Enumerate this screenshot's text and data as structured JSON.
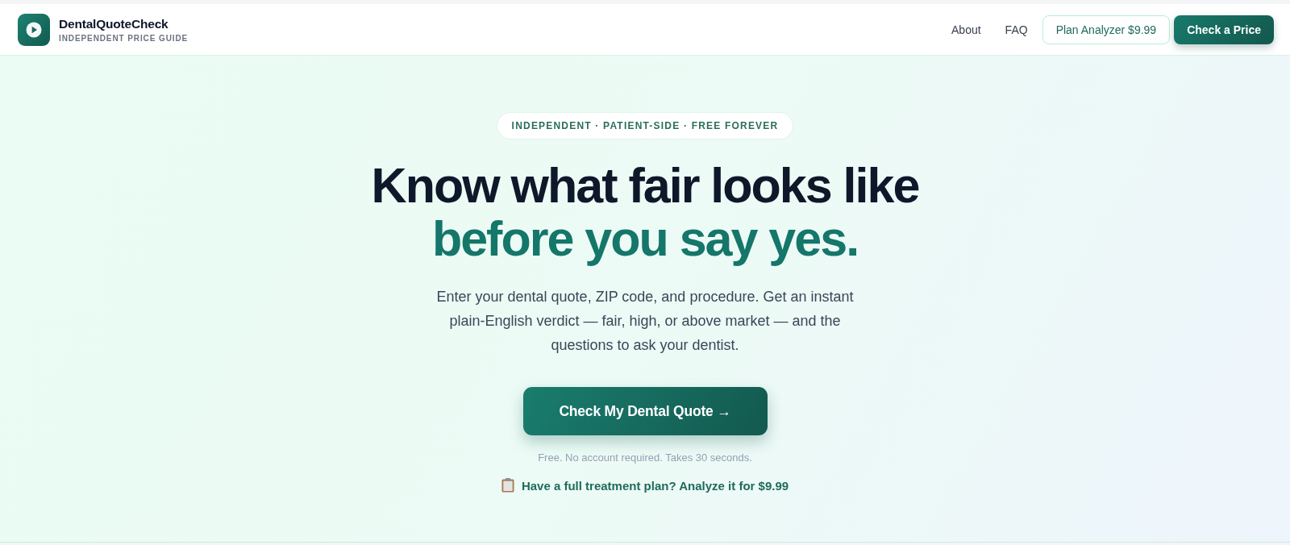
{
  "header": {
    "brand": {
      "name": "DentalQuoteCheck",
      "tagline": "INDEPENDENT PRICE GUIDE"
    },
    "nav": [
      {
        "label": "About",
        "kind": "link"
      },
      {
        "label": "FAQ",
        "kind": "link"
      },
      {
        "label": "Plan Analyzer $9.99",
        "kind": "outline"
      },
      {
        "label": "Check a Price",
        "kind": "primary"
      }
    ]
  },
  "hero": {
    "badge": "INDEPENDENT · PATIENT-SIDE · FREE FOREVER",
    "headline": [
      {
        "text": "Know what fair looks like",
        "kind": "plain"
      },
      {
        "text": "before you say yes.",
        "kind": "accent"
      }
    ],
    "description": "Enter your dental quote, ZIP code, and procedure. Get an instant plain-English verdict — fair, high, or above market — and the questions to ask your dentist.",
    "cta": {
      "label": "Check My Dental Quote →"
    },
    "note": "Free. No account required. Takes 30 seconds.",
    "plan_link": {
      "label": "Have a full treatment plan? Analyze it for $9.99"
    }
  }
}
